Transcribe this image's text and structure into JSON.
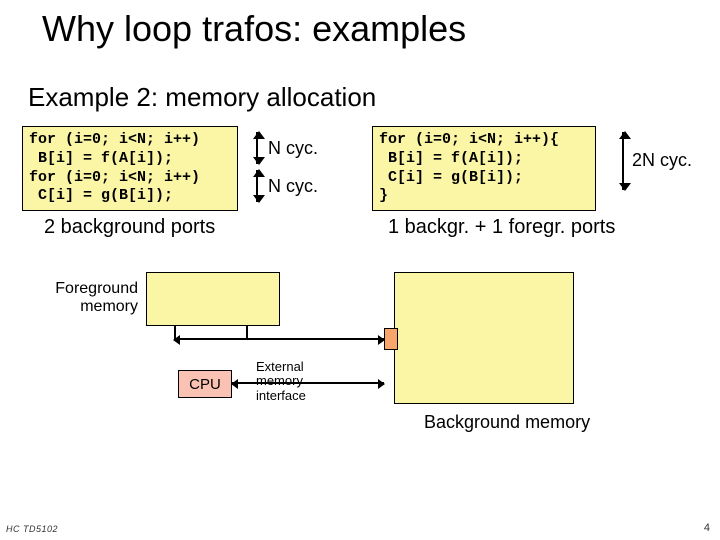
{
  "title": "Why loop trafos: examples",
  "subtitle": "Example 2: memory allocation",
  "code_left": "for (i=0; i<N; i++)\n B[i] = f(A[i]);\nfor (i=0; i<N; i++)\n C[i] = g(B[i]);",
  "code_right": "for (i=0; i<N; i++){\n B[i] = f(A[i]);\n C[i] = g(B[i]);\n}",
  "ann_ncyc1": "N cyc.",
  "ann_ncyc2": "N cyc.",
  "ann_2ncyc": "2N cyc.",
  "caption_left": "2 background ports",
  "caption_right": "1 backgr. + 1 foregr. ports",
  "fg_label_l1": "Foreground",
  "fg_label_l2": "memory",
  "cpu_label": "CPU",
  "ext_label_l1": "External",
  "ext_label_l2": "memory",
  "ext_label_l3": "interface",
  "bg_label": "Background memory",
  "footer_left": "HC  TD5102",
  "footer_right": "4"
}
